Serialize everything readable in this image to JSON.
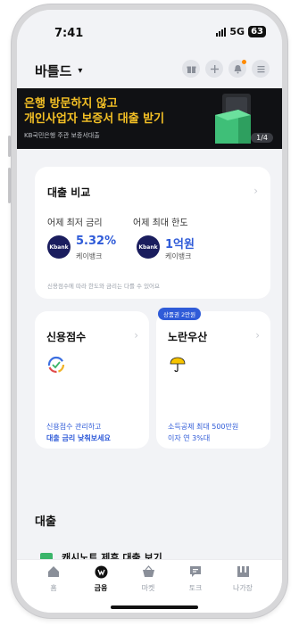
{
  "status": {
    "time": "7:41",
    "network": "5G",
    "battery": "63"
  },
  "header": {
    "brand": "바틀드",
    "caret": "▾"
  },
  "banner": {
    "line1": "은행 방문하지 않고",
    "line2": "개인사업자 보증서 대출 받기",
    "sub": "KB국민은행 주관 보증서대출",
    "indicator": "1/4"
  },
  "loan_compare": {
    "title": "대출 비교",
    "min_rate_label": "어제 최저 금리",
    "max_limit_label": "어제 최대 한도",
    "min_rate_value": "5.32%",
    "max_limit_value": "1억원",
    "bank_logo": "Kbank",
    "bank_name": "케이뱅크",
    "note": "신용점수에 따라 한도와 금리는 다를 수 있어요"
  },
  "credit_card": {
    "title": "신용점수",
    "line1": "신용점수 관리하고",
    "line2": "대출 금리 낮춰보세요"
  },
  "umbrella_card": {
    "badge": "상품권 2만원",
    "title": "노란우산",
    "line1": "소득공제 최대 500만원",
    "line2": "이자 연 3%대"
  },
  "section": {
    "title": "대출",
    "item": "캐시노트 제휴 대출 보기"
  },
  "tabs": [
    {
      "label": "홈",
      "icon": "home-icon"
    },
    {
      "label": "금융",
      "icon": "finance-icon"
    },
    {
      "label": "마켓",
      "icon": "basket-icon"
    },
    {
      "label": "토크",
      "icon": "chat-icon"
    },
    {
      "label": "나가장",
      "icon": "store-icon"
    }
  ],
  "colors": {
    "accent": "#2f5bd8",
    "banner_text": "#f4c025",
    "bank_logo": "#1a1d5e"
  }
}
